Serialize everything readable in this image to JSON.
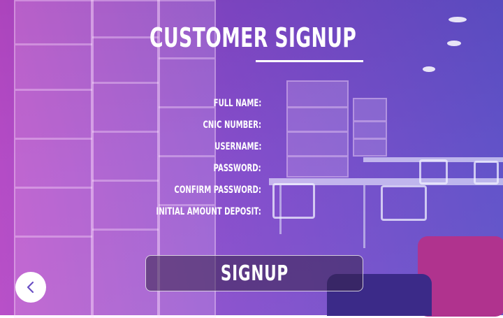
{
  "title": "CUSTOMER SIGNUP",
  "form": {
    "fields": [
      {
        "label": "FULL NAME:"
      },
      {
        "label": "CNIC NUMBER:"
      },
      {
        "label": "USERNAME:"
      },
      {
        "label": "PASSWORD:"
      },
      {
        "label": "CONFIRM PASSWORD:"
      },
      {
        "label": "INITIAL AMOUNT DEPOSIT:"
      }
    ]
  },
  "signup_button": {
    "label": "SIGNUP"
  },
  "back_button": {
    "icon": "chevron-left-icon"
  },
  "colors": {
    "overlay_pink": "#cd46c8",
    "overlay_blue": "#5f50cd",
    "text": "#ffffff"
  }
}
